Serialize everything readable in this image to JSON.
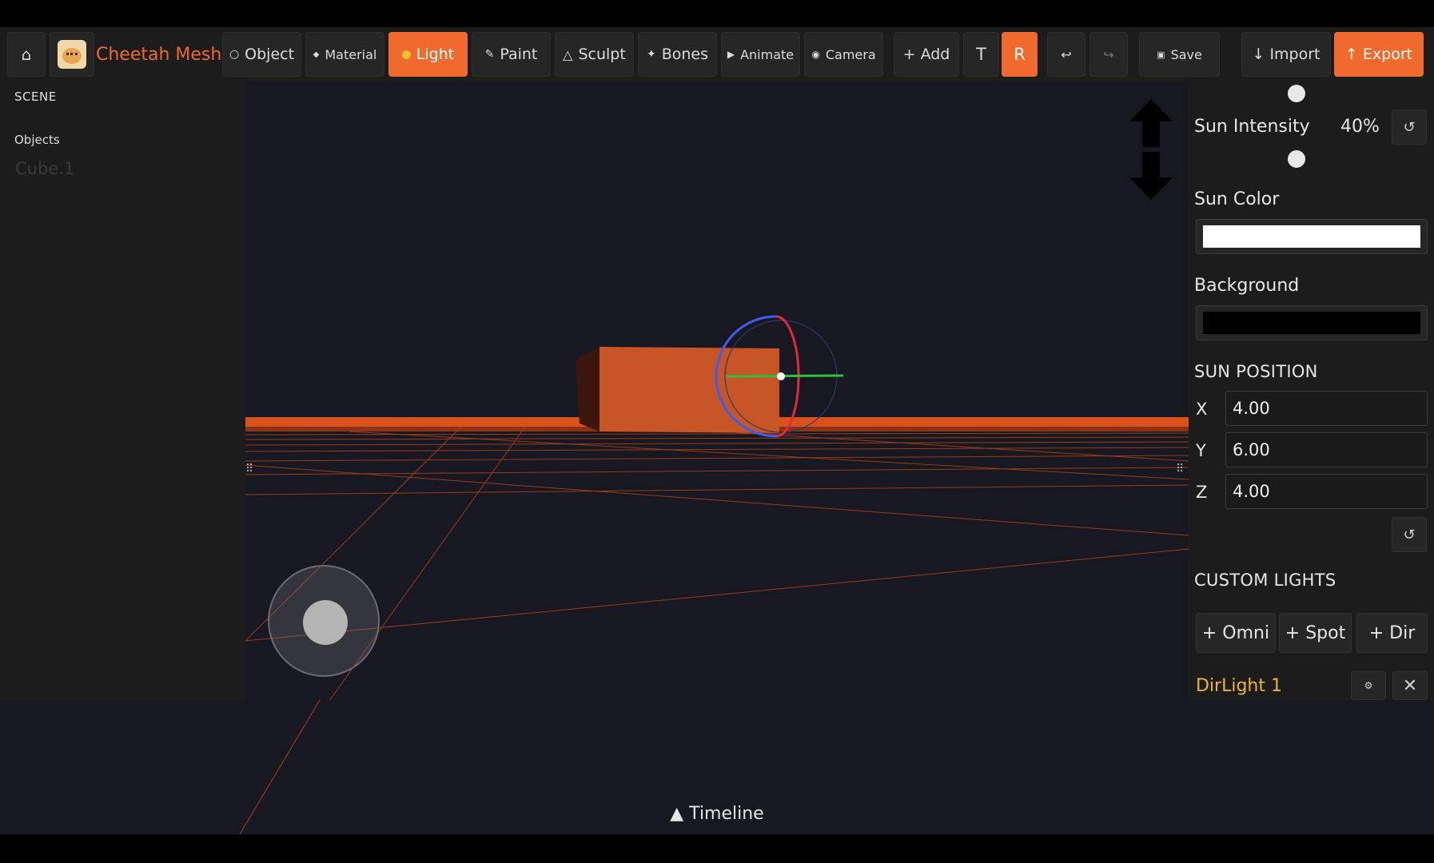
{
  "app": {
    "title": "Cheetah Mesh"
  },
  "toolbar": {
    "home_icon": "home-icon",
    "modes": [
      {
        "label": "Object",
        "icon": "circle-outline-icon"
      },
      {
        "label": "Material",
        "icon": "diamond-icon"
      },
      {
        "label": "Light",
        "icon": "bulb-icon",
        "active": true
      },
      {
        "label": "Paint",
        "icon": "brush-icon"
      },
      {
        "label": "Sculpt",
        "icon": "triangle-icon"
      },
      {
        "label": "Bones",
        "icon": "star-icon"
      },
      {
        "label": "Animate",
        "icon": "play-icon"
      },
      {
        "label": "Camera",
        "icon": "record-icon"
      }
    ],
    "add_label": "+ Add",
    "t_label": "T",
    "r_label": "R",
    "undo_icon": "undo-icon",
    "redo_icon": "redo-icon",
    "save_label": "Save",
    "import_label": "↓ Import",
    "export_label": "↑ Export"
  },
  "scene": {
    "header": "SCENE",
    "objects_label": "Objects",
    "objects": [
      "Cube.1"
    ]
  },
  "light_panel": {
    "sun_intensity_label": "Sun Intensity",
    "sun_intensity_value": "40%",
    "sun_color_label": "Sun Color",
    "sun_color": "#ffffff",
    "background_label": "Background",
    "background_color": "#000000",
    "sun_position_header": "SUN POSITION",
    "sun_position": {
      "x_label": "X",
      "x": "4.00",
      "y_label": "Y",
      "y": "6.00",
      "z_label": "Z",
      "z": "4.00"
    },
    "custom_lights_header": "CUSTOM LIGHTS",
    "add_omni_label": "+ Omni",
    "add_spot_label": "+ Spot",
    "add_dir_label": "+ Dir",
    "lights": [
      {
        "name": "DirLight 1"
      }
    ]
  },
  "timeline": {
    "label": "▲ Timeline"
  },
  "colors": {
    "accent": "#ef6a2c",
    "panel": "#1c1c1c",
    "viewport": "#181822",
    "highlight": "#f0b429"
  }
}
